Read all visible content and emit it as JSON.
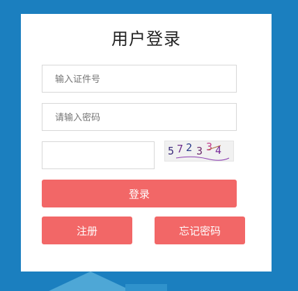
{
  "title": "用户登录",
  "fields": {
    "id_placeholder": "输入证件号",
    "password_placeholder": "请输入密码",
    "captcha_value": ""
  },
  "captcha": {
    "text": "572334",
    "colors": [
      "#3a2a7a",
      "#6b2a8a",
      "#2a3a8a",
      "#6b2a6b",
      "#c23a8a",
      "#7a2a9a"
    ]
  },
  "buttons": {
    "login": "登录",
    "register": "注册",
    "forgot": "忘记密码"
  },
  "colors": {
    "background": "#1b7fbf",
    "card": "#ffffff",
    "button": "#f26767"
  }
}
